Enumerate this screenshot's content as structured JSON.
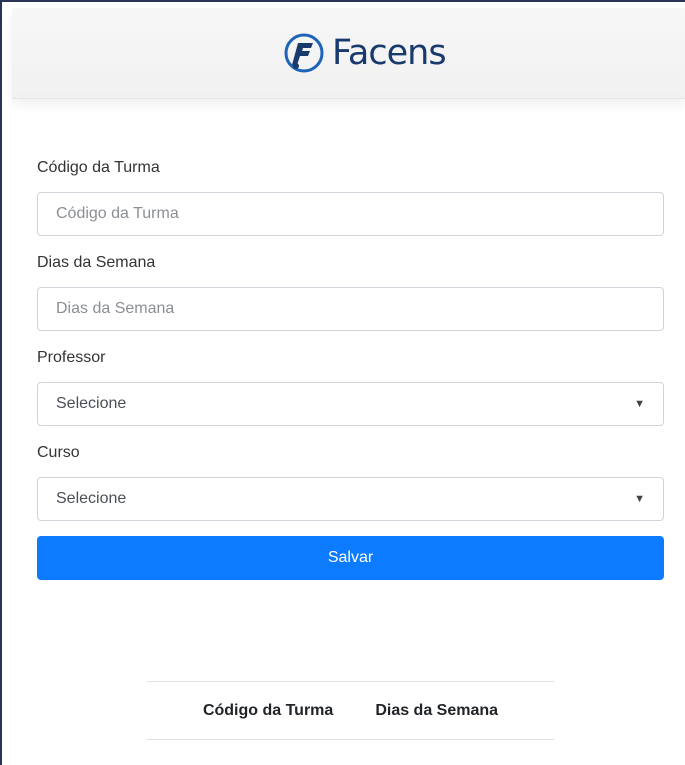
{
  "header": {
    "logo_text": "Facens"
  },
  "form": {
    "codigo": {
      "label": "Código da Turma",
      "placeholder": "Código da Turma",
      "value": ""
    },
    "dias": {
      "label": "Dias da Semana",
      "placeholder": "Dias da Semana",
      "value": ""
    },
    "professor": {
      "label": "Professor",
      "selected": "Selecione"
    },
    "curso": {
      "label": "Curso",
      "selected": "Selecione"
    },
    "save_label": "Salvar"
  },
  "table": {
    "headers": [
      "Código da Turma",
      "Dias da Semana"
    ]
  },
  "icons": {
    "logo": "facens-logo-icon",
    "select_caret": "caret-down-icon"
  },
  "colors": {
    "brand_blue": "#183a6c",
    "button_blue": "#0d7bff"
  }
}
